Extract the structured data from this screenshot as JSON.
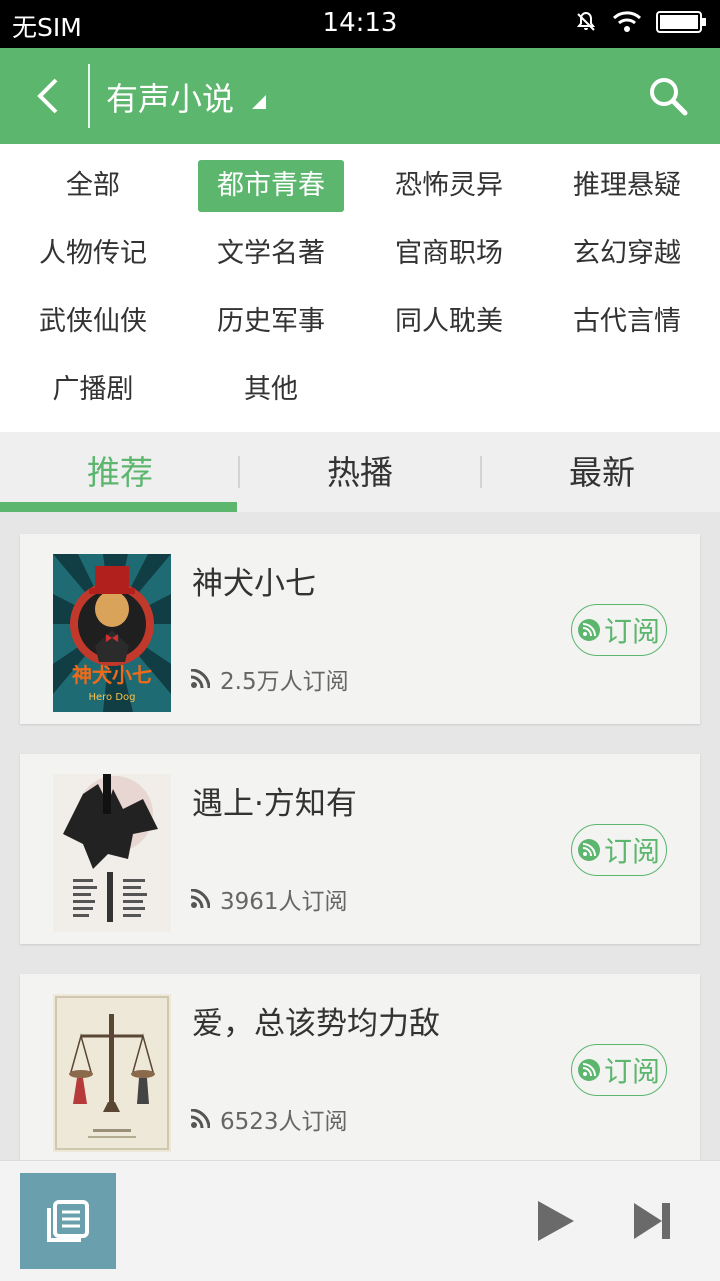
{
  "status": {
    "carrier": "无SIM",
    "time": "14:13"
  },
  "appbar": {
    "title": "有声小说"
  },
  "categories": [
    {
      "label": "全部",
      "active": false
    },
    {
      "label": "都市青春",
      "active": true
    },
    {
      "label": "恐怖灵异",
      "active": false
    },
    {
      "label": "推理悬疑",
      "active": false
    },
    {
      "label": "人物传记",
      "active": false
    },
    {
      "label": "文学名著",
      "active": false
    },
    {
      "label": "官商职场",
      "active": false
    },
    {
      "label": "玄幻穿越",
      "active": false
    },
    {
      "label": "武侠仙侠",
      "active": false
    },
    {
      "label": "历史军事",
      "active": false
    },
    {
      "label": "同人耽美",
      "active": false
    },
    {
      "label": "古代言情",
      "active": false
    },
    {
      "label": "广播剧",
      "active": false
    },
    {
      "label": "其他",
      "active": false
    }
  ],
  "tabs": [
    {
      "label": "推荐",
      "active": true
    },
    {
      "label": "热播",
      "active": false
    },
    {
      "label": "最新",
      "active": false
    }
  ],
  "books": [
    {
      "title": "神犬小七",
      "subscribers": "2.5万人订阅",
      "subscribe_label": "订阅",
      "cover_text": "神犬小七"
    },
    {
      "title": "遇上·方知有",
      "subscribers": "3961人订阅",
      "subscribe_label": "订阅"
    },
    {
      "title": "爱，总该势均力敌",
      "subscribers": "6523人订阅",
      "subscribe_label": "订阅"
    }
  ],
  "colors": {
    "brand_green": "#5cb66e",
    "thumb_blue": "#6aa0ae"
  }
}
